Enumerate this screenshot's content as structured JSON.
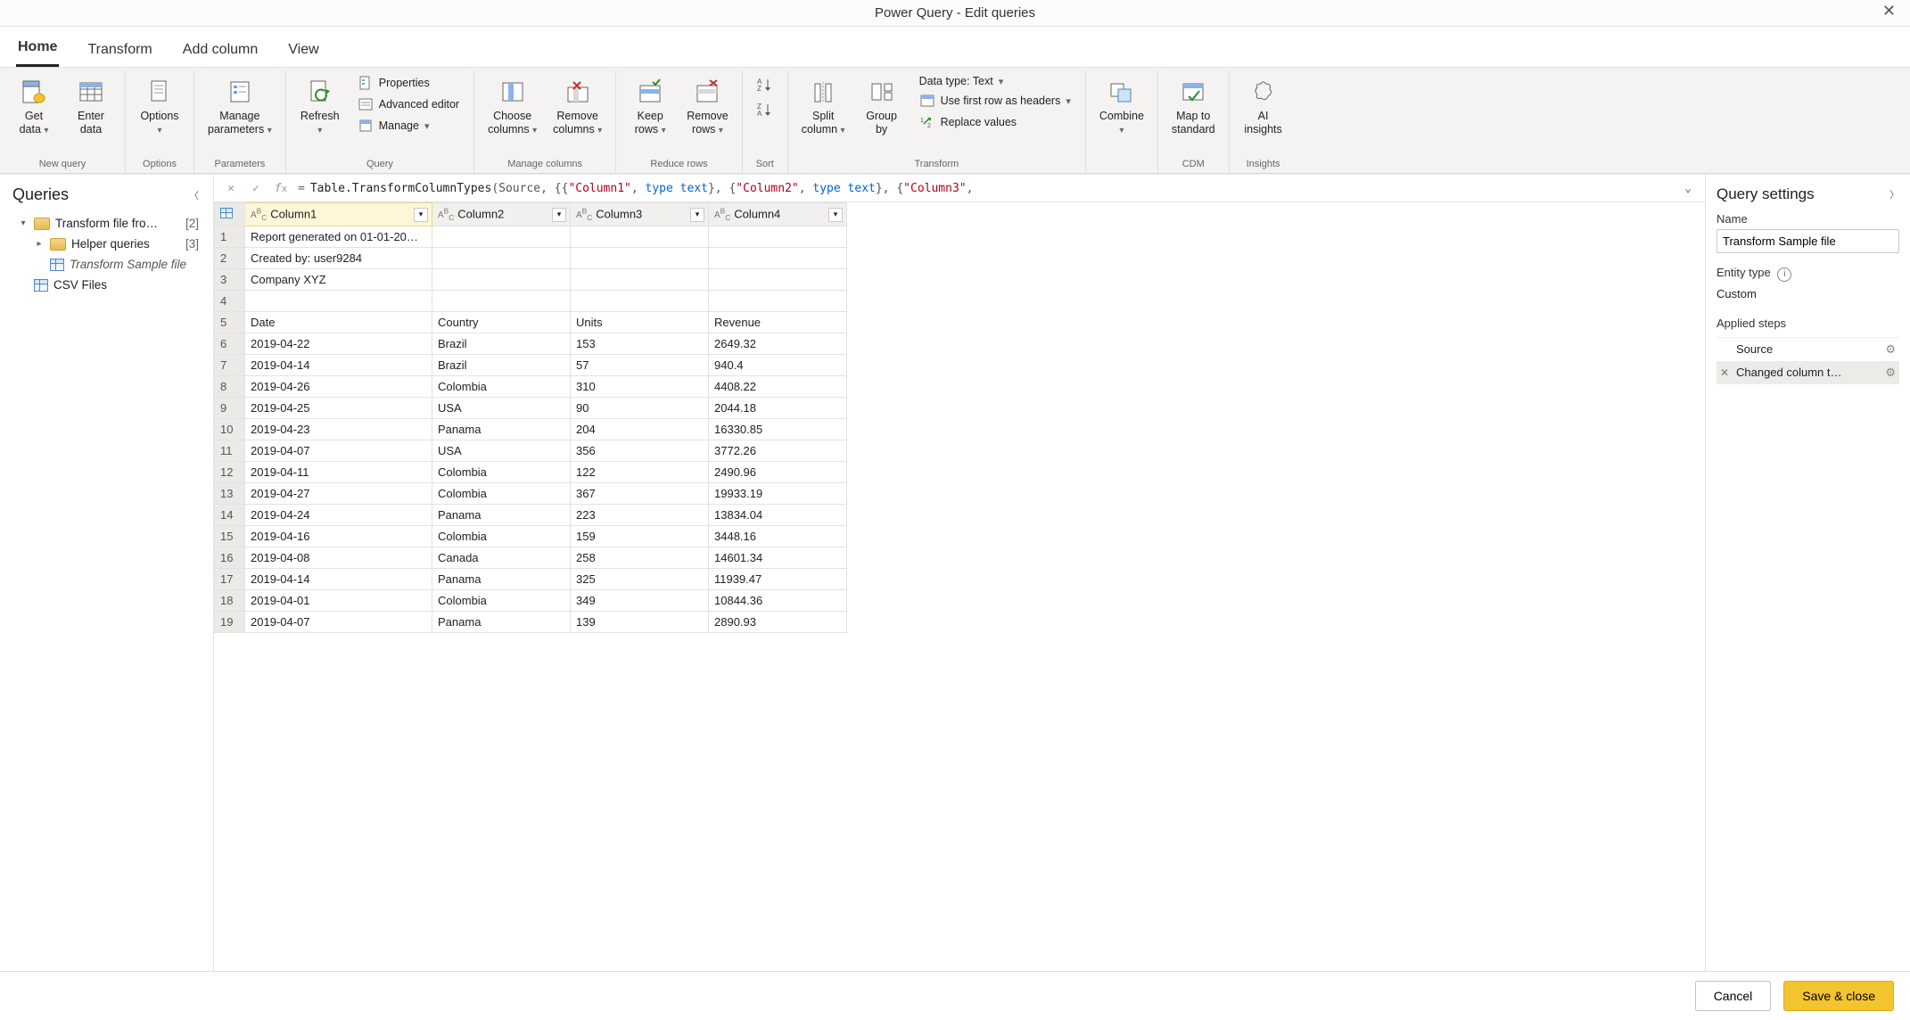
{
  "window": {
    "title": "Power Query - Edit queries"
  },
  "tabs": {
    "home": "Home",
    "transform": "Transform",
    "addcolumn": "Add column",
    "view": "View"
  },
  "ribbon": {
    "newquery": {
      "getdata": "Get\ndata",
      "enterdata": "Enter\ndata",
      "group": "New query"
    },
    "options": {
      "options": "Options",
      "group": "Options"
    },
    "parameters": {
      "manage": "Manage\nparameters",
      "group": "Parameters"
    },
    "query": {
      "refresh": "Refresh",
      "properties": "Properties",
      "advanced": "Advanced editor",
      "manage": "Manage",
      "group": "Query"
    },
    "managecols": {
      "choose": "Choose\ncolumns",
      "remove": "Remove\ncolumns",
      "group": "Manage columns"
    },
    "reduce": {
      "keep": "Keep\nrows",
      "remove": "Remove\nrows",
      "group": "Reduce rows"
    },
    "sort": {
      "group": "Sort"
    },
    "transform": {
      "split": "Split\ncolumn",
      "groupby": "Group\nby",
      "datatype": "Data type: Text",
      "firstrow": "Use first row as headers",
      "replace": "Replace values",
      "group": "Transform"
    },
    "combine": {
      "combine": "Combine",
      "group": ""
    },
    "cdm": {
      "map": "Map to\nstandard",
      "group": "CDM"
    },
    "insights": {
      "ai": "AI\ninsights",
      "group": "Insights"
    }
  },
  "queries": {
    "title": "Queries",
    "items": [
      {
        "kind": "folder",
        "expander": "▾",
        "label": "Transform file fro…",
        "count": "[2]",
        "indent": 0
      },
      {
        "kind": "folder",
        "expander": "▸",
        "label": "Helper queries",
        "count": "[3]",
        "indent": 1
      },
      {
        "kind": "query",
        "label": "Transform Sample file",
        "selected": true,
        "indent": 1
      },
      {
        "kind": "query",
        "label": "CSV Files",
        "indent": 0
      }
    ]
  },
  "formula": {
    "parts": [
      {
        "t": "eq",
        "v": "="
      },
      {
        "t": "fn",
        "v": "Table.TransformColumnTypes"
      },
      {
        "t": "pn",
        "v": "(Source, {{"
      },
      {
        "t": "str",
        "v": "\"Column1\""
      },
      {
        "t": "pn",
        "v": ", "
      },
      {
        "t": "kw",
        "v": "type text"
      },
      {
        "t": "pn",
        "v": "}, {"
      },
      {
        "t": "str",
        "v": "\"Column2\""
      },
      {
        "t": "pn",
        "v": ", "
      },
      {
        "t": "kw",
        "v": "type text"
      },
      {
        "t": "pn",
        "v": "}, {"
      },
      {
        "t": "str",
        "v": "\"Column3\""
      },
      {
        "t": "pn",
        "v": ","
      }
    ]
  },
  "grid": {
    "columns": [
      {
        "name": "Column1",
        "selected": true
      },
      {
        "name": "Column2"
      },
      {
        "name": "Column3"
      },
      {
        "name": "Column4"
      }
    ],
    "rows": [
      [
        "Report generated on 01-01-20…",
        "",
        "",
        ""
      ],
      [
        "Created by: user9284",
        "",
        "",
        ""
      ],
      [
        "Company XYZ",
        "",
        "",
        ""
      ],
      [
        "",
        "",
        "",
        ""
      ],
      [
        "Date",
        "Country",
        "Units",
        "Revenue"
      ],
      [
        "2019-04-22",
        "Brazil",
        "153",
        "2649.32"
      ],
      [
        "2019-04-14",
        "Brazil",
        "57",
        "940.4"
      ],
      [
        "2019-04-26",
        "Colombia",
        "310",
        "4408.22"
      ],
      [
        "2019-04-25",
        "USA",
        "90",
        "2044.18"
      ],
      [
        "2019-04-23",
        "Panama",
        "204",
        "16330.85"
      ],
      [
        "2019-04-07",
        "USA",
        "356",
        "3772.26"
      ],
      [
        "2019-04-11",
        "Colombia",
        "122",
        "2490.96"
      ],
      [
        "2019-04-27",
        "Colombia",
        "367",
        "19933.19"
      ],
      [
        "2019-04-24",
        "Panama",
        "223",
        "13834.04"
      ],
      [
        "2019-04-16",
        "Colombia",
        "159",
        "3448.16"
      ],
      [
        "2019-04-08",
        "Canada",
        "258",
        "14601.34"
      ],
      [
        "2019-04-14",
        "Panama",
        "325",
        "11939.47"
      ],
      [
        "2019-04-01",
        "Colombia",
        "349",
        "10844.36"
      ],
      [
        "2019-04-07",
        "Panama",
        "139",
        "2890.93"
      ]
    ]
  },
  "settings": {
    "title": "Query settings",
    "nameLabel": "Name",
    "name": "Transform Sample file",
    "entityLabel": "Entity type",
    "entity": "Custom",
    "stepsLabel": "Applied steps",
    "steps": [
      {
        "label": "Source",
        "gear": true
      },
      {
        "label": "Changed column t…",
        "gear": true,
        "del": true,
        "selected": true
      }
    ]
  },
  "footer": {
    "cancel": "Cancel",
    "save": "Save & close"
  }
}
